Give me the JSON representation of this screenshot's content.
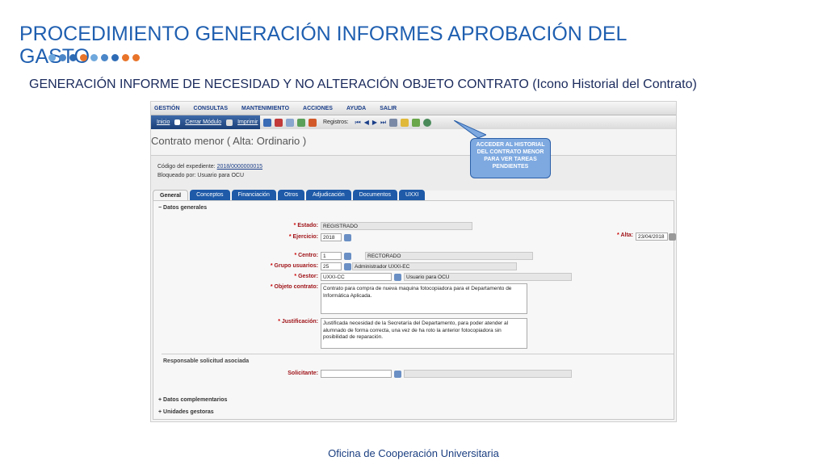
{
  "slide": {
    "title": "PROCEDIMIENTO GENERACIÓN INFORMES APROBACIÓN DEL GASTO",
    "subtitle": "GENERACIÓN INFORME DE NECESIDAD Y NO ALTERACIÓN OBJETO CONTRATO (Icono Historial del Contrato)",
    "footer": "Oficina de Cooperación Universitaria",
    "dot_colors": [
      "#6fa8dc",
      "#4a86c8",
      "#2e6bb5",
      "#e8742a",
      "#6fa8dc",
      "#4a86c8",
      "#2e6bb5",
      "#e8742a",
      "#e8742a"
    ]
  },
  "app": {
    "menu": [
      "Gestión",
      "Consultas",
      "Mantenimiento",
      "Acciones",
      "Ayuda",
      "Salir"
    ],
    "toolbar": {
      "inicio": "Inicio",
      "cerrar": "Cerrar Módulo",
      "imprimir": "Imprimir",
      "registros": "Registros:"
    },
    "form_title": "Contrato menor ( Alta: Ordinario )",
    "codigo_label": "Código del expediente:",
    "codigo_value": "2018/0000000015",
    "bloqueado": "Bloqueado por: Usuario para OCU",
    "tabs": [
      "General",
      "Conceptos",
      "Financiación",
      "Otros",
      "Adjudicación",
      "Documentos",
      "UXXI"
    ],
    "sections": {
      "datos_generales": "Datos generales",
      "responsable": "Responsable solicitud asociada",
      "datos_complementarios": "Datos complementarios",
      "unidades_gestoras": "Unidades gestoras"
    },
    "fields": {
      "estado_label": "Estado:",
      "estado_value": "REGISTRADO",
      "ejercicio_label": "Ejercicio:",
      "ejercicio_value": "2018",
      "alta_label": "Alta:",
      "alta_value": "23/04/2018",
      "centro_label": "Centro:",
      "centro_code": "1",
      "centro_desc": "RECTORADO",
      "grupo_label": "Grupo usuarios:",
      "grupo_code": "25",
      "grupo_desc": "Administrador UXXI-EC",
      "gestor_label": "Gestor:",
      "gestor_code": "UXXI-CC",
      "gestor_desc": "Usuario para OCU",
      "objeto_label": "Objeto contrato:",
      "objeto_value": "Contrato para compra de nueva maquina fotocopiadora para el Departamento de Informática Aplicada.",
      "justif_label": "Justificación:",
      "justif_value": "Justificada necesidad de la Secretaría del Departamento, para poder atender al alumnado de forma correcta, una vez de ha roto la anterior fotocopiadora sin posibilidad de reparación.",
      "solicitante_label": "Solicitante:"
    },
    "callout": "ACCEDER AL HISTORIAL DEL CONTRATO MENOR PARA VER TAREAS PENDIENTES"
  }
}
